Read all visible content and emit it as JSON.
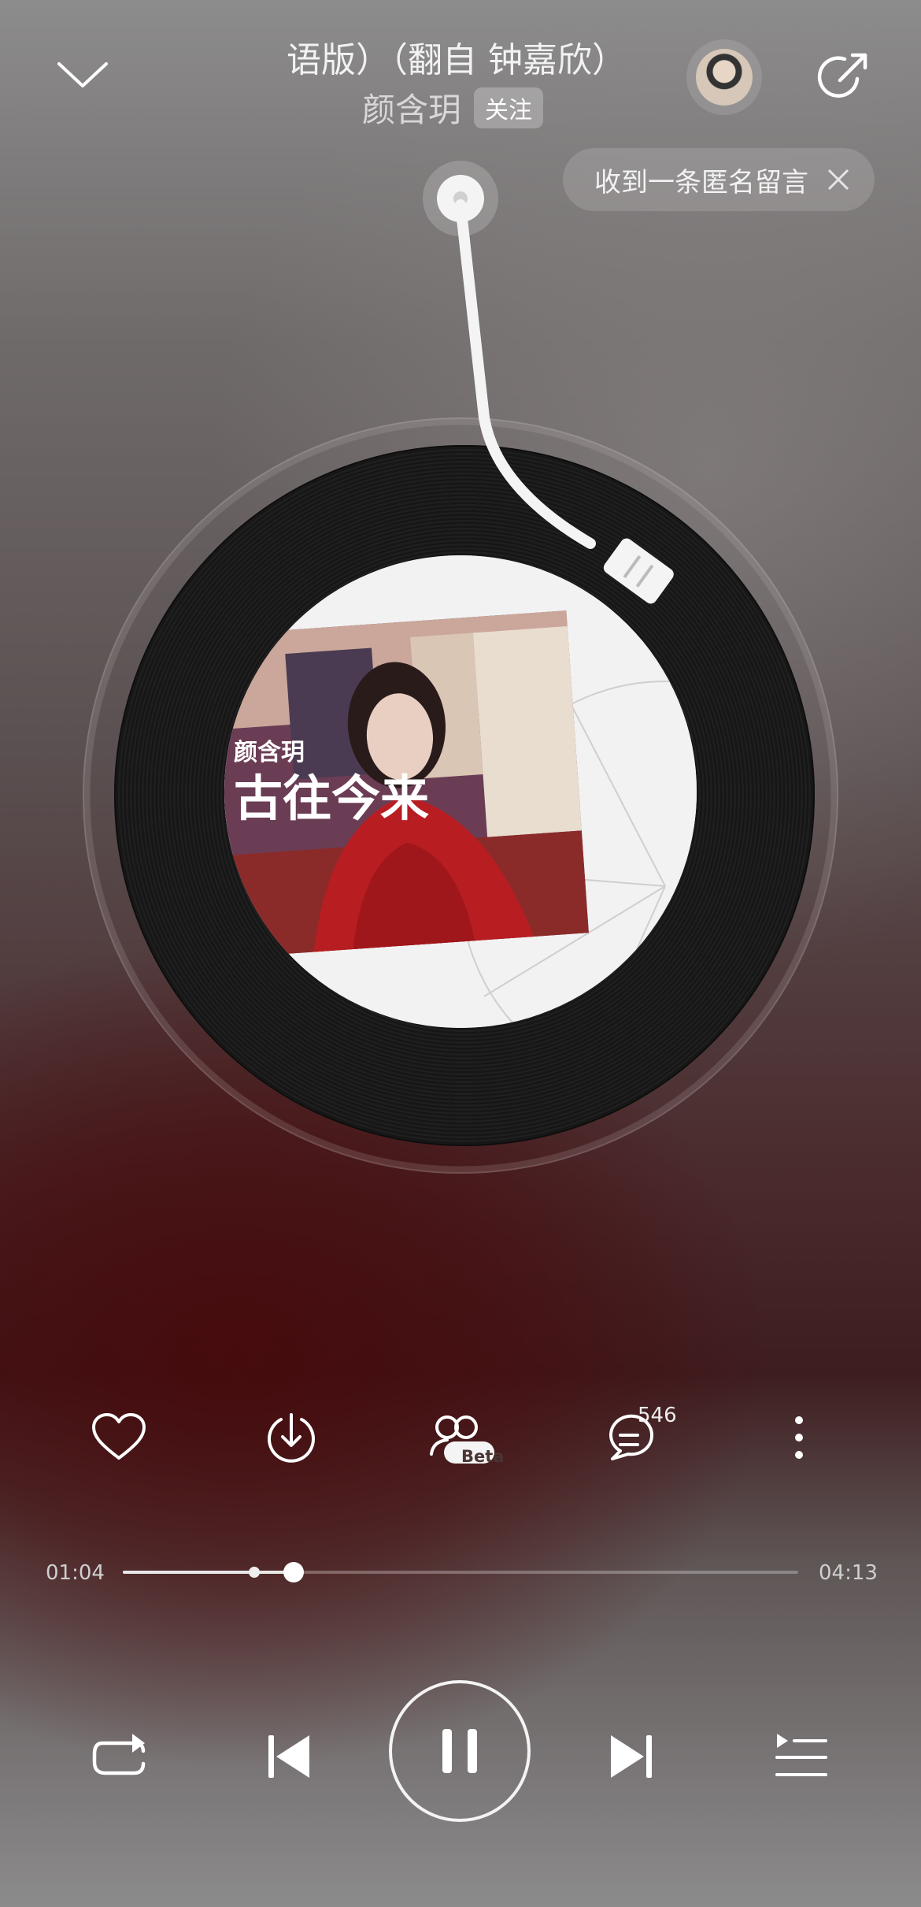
{
  "header": {
    "song_title": "语版）（翻自 钟嘉欣）",
    "artist": "颜含玥",
    "follow_label": "关注"
  },
  "notice": {
    "text": "收到一条匿名留言"
  },
  "album_cover": {
    "artist_text": "颜含玥",
    "album_text": "古往今来"
  },
  "actions": {
    "beta_badge": "Beta",
    "comment_count": "546"
  },
  "progress": {
    "current_time": "01:04",
    "total_time": "04:13",
    "played_fraction": 0.253,
    "buffered_fraction": 0.195
  },
  "icons": {
    "collapse": "chevron-down-icon",
    "share": "share-icon",
    "close": "close-icon",
    "like": "heart-icon",
    "download": "download-icon",
    "listen_together": "listen-together-icon",
    "comment": "comment-icon",
    "more": "more-vertical-icon",
    "repeat": "repeat-icon",
    "previous": "previous-icon",
    "pause": "pause-icon",
    "next": "next-icon",
    "playlist": "playlist-icon"
  }
}
